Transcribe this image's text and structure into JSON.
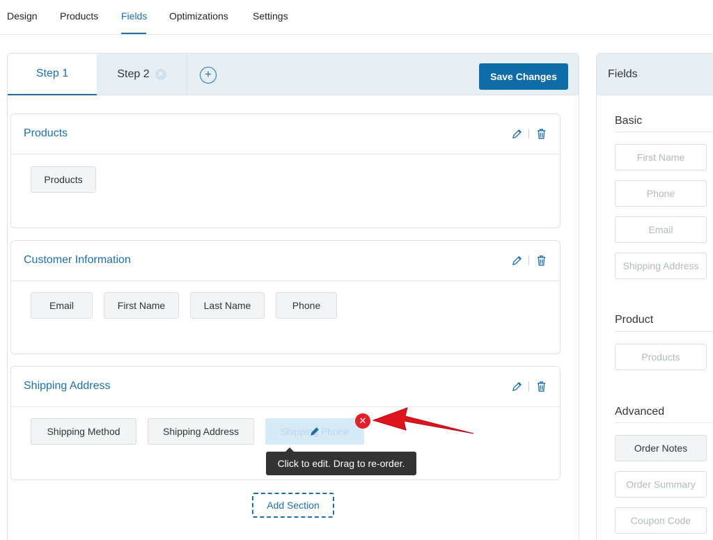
{
  "topnav": {
    "tabs": [
      "Design",
      "Products",
      "Fields",
      "Optimizations",
      "Settings"
    ],
    "active": "Fields"
  },
  "steps": {
    "step1": "Step 1",
    "step2": "Step 2",
    "add_icon": "plus-icon"
  },
  "toolbar": {
    "save_label": "Save Changes"
  },
  "sections": [
    {
      "title": "Products",
      "fields": [
        "Products"
      ]
    },
    {
      "title": "Customer Information",
      "fields": [
        "Email",
        "First Name",
        "Last Name",
        "Phone"
      ]
    },
    {
      "title": "Shipping Address",
      "fields": [
        "Shipping Method",
        "Shipping Address",
        "Shipping Phone"
      ]
    }
  ],
  "tooltip": "Click to edit. Drag to re-order.",
  "add_section_label": "Add Section",
  "fields_panel": {
    "title": "Fields",
    "groups": [
      {
        "title": "Basic",
        "items": [
          "First Name",
          "Phone",
          "Email",
          "Shipping Address"
        ]
      },
      {
        "title": "Product",
        "items": [
          "Products"
        ]
      },
      {
        "title": "Advanced",
        "items": [
          "Order Notes",
          "Order Summary",
          "Coupon Code"
        ]
      }
    ]
  },
  "colors": {
    "accent": "#1e6fa8",
    "save_button": "#0f6ca6",
    "remove_badge": "#e2202a",
    "arrow": "#e0141e"
  }
}
